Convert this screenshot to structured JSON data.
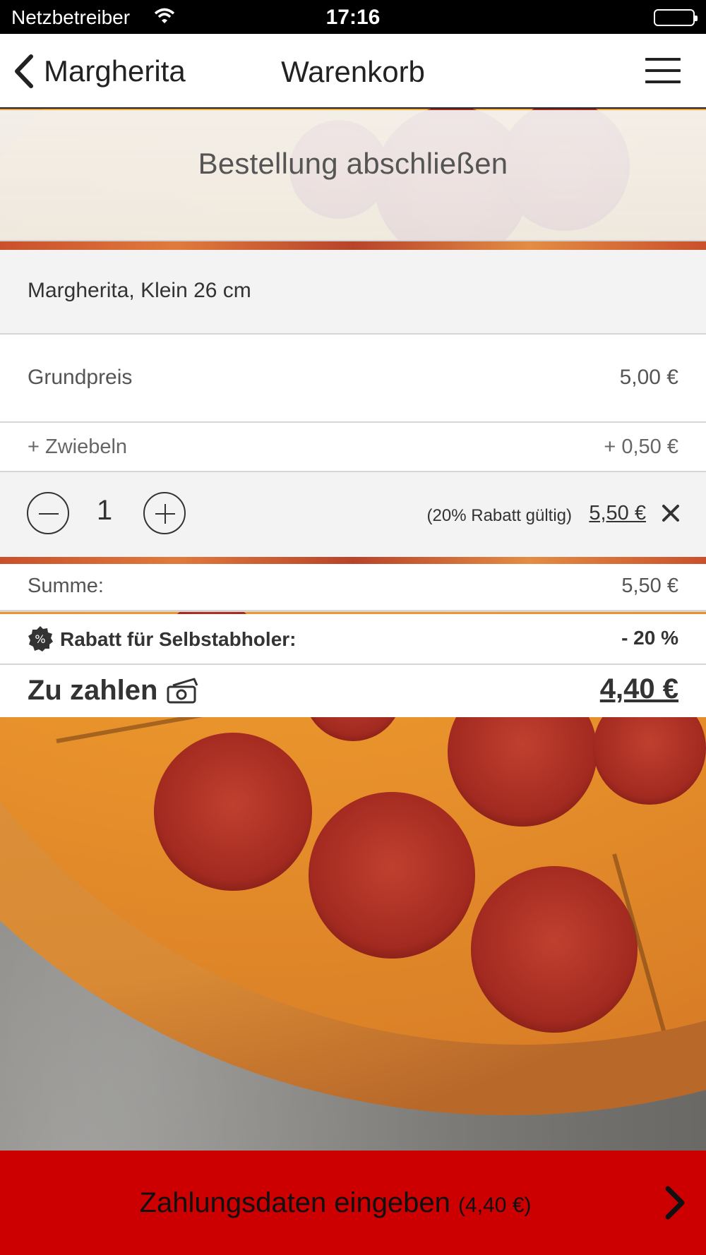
{
  "status_bar": {
    "carrier": "Netzbetreiber",
    "time": "17:16"
  },
  "nav": {
    "back_label": "Margherita",
    "title": "Warenkorb"
  },
  "banner": {
    "title": "Bestellung abschließen"
  },
  "cart_item": {
    "name": "Margherita, Klein 26 cm",
    "base_label": "Grundpreis",
    "base_price": "5,00 €",
    "extras": [
      {
        "label": "+ Zwiebeln",
        "price": "+ 0,50 €"
      }
    ],
    "quantity": "1",
    "discount_note": "(20% Rabatt gültig)",
    "item_total": "5,50 €"
  },
  "summary": {
    "sum_label": "Summe:",
    "sum_value": "5,50 €",
    "discount_label": "Rabatt für Selbstabholer:",
    "discount_value": "- 20 %",
    "pay_label": "Zu zahlen",
    "pay_value": "4,40 €"
  },
  "cta": {
    "label": "Zahlungsdaten eingeben",
    "amount": "(4,40 €)"
  },
  "colors": {
    "cta": "#cc0000",
    "row_alt": "#f3f3f3",
    "text": "#333333"
  },
  "icons": [
    "wifi-icon",
    "battery-icon",
    "back-chevron-icon",
    "hamburger-menu-icon",
    "minus-icon",
    "plus-icon",
    "close-icon",
    "percent-badge-icon",
    "money-icon",
    "chevron-right-icon"
  ]
}
